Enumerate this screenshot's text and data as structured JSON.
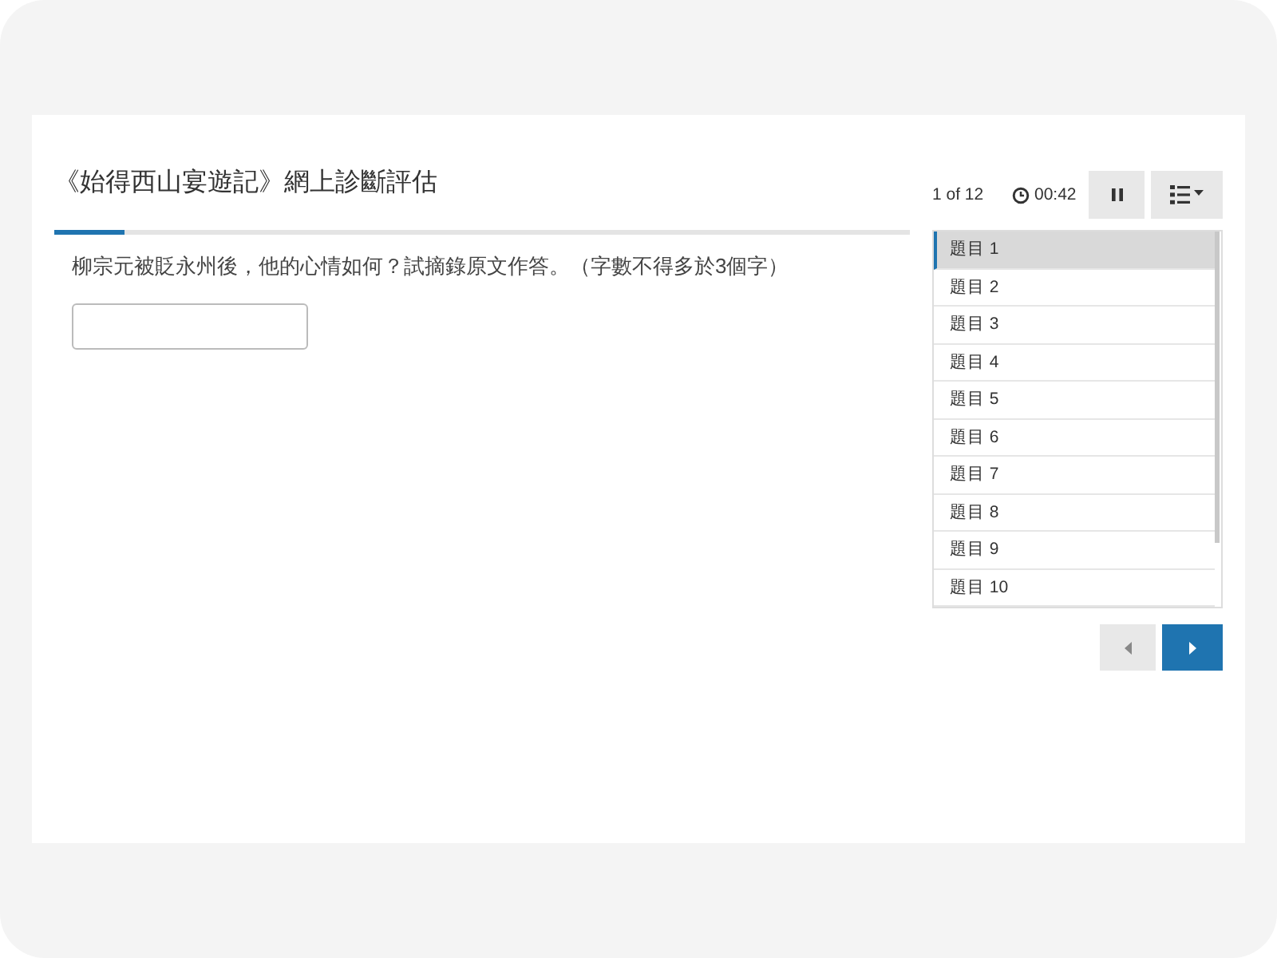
{
  "title": "《始得西山宴遊記》網上診斷評估",
  "progress": {
    "level": 0.083
  },
  "question": "柳宗元被貶永州後，他的心情如何？試摘錄原文作答。（字數不得多於3個字）",
  "counter": "1 of 12",
  "timer": "00:42",
  "questions": [
    {
      "label": "題目 1",
      "selected": true
    },
    {
      "label": "題目 2",
      "selected": false
    },
    {
      "label": "題目 3",
      "selected": false
    },
    {
      "label": "題目 4",
      "selected": false
    },
    {
      "label": "題目 5",
      "selected": false
    },
    {
      "label": "題目 6",
      "selected": false
    },
    {
      "label": "題目 7",
      "selected": false
    },
    {
      "label": "題目 8",
      "selected": false
    },
    {
      "label": "題目 9",
      "selected": false
    },
    {
      "label": "題目 10",
      "selected": false
    }
  ],
  "nav": {
    "previous_disabled": true,
    "next_disabled": false
  }
}
